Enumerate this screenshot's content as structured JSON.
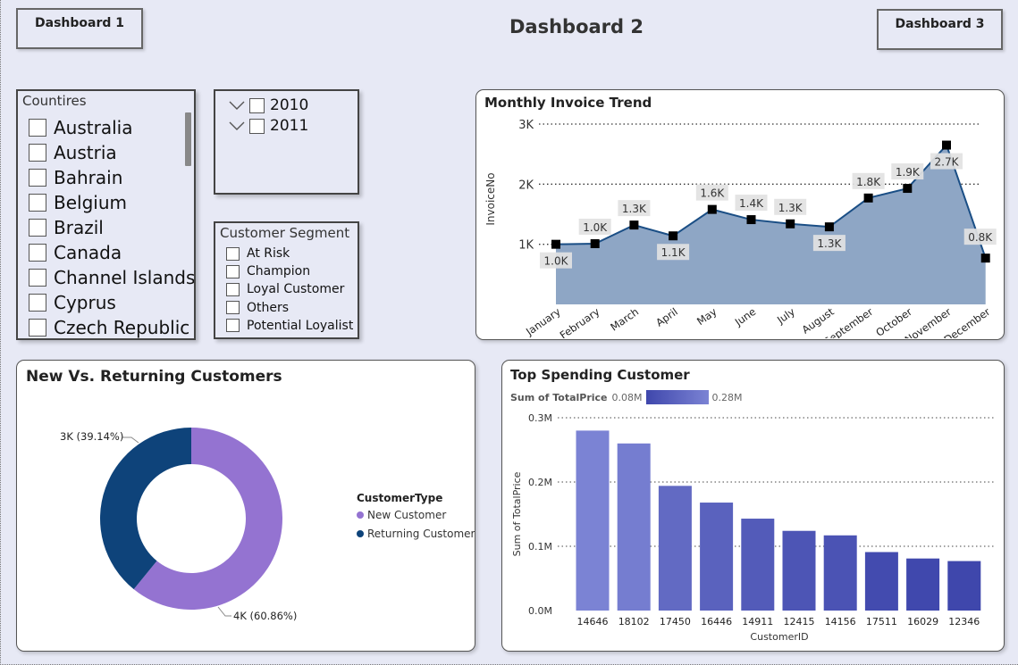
{
  "header": {
    "title": "Dashboard 2",
    "nav_left": "Dashboard 1",
    "nav_right": "Dashboard 3"
  },
  "country_slicer": {
    "title": "Countires",
    "items": [
      "Australia",
      "Austria",
      "Bahrain",
      "Belgium",
      "Brazil",
      "Canada",
      "Channel Islands",
      "Cyprus",
      "Czech Republic"
    ]
  },
  "year_slicer": {
    "items": [
      "2010",
      "2011"
    ]
  },
  "segment_slicer": {
    "title": "Customer Segment",
    "items": [
      "At Risk",
      "Champion",
      "Loyal Customer",
      "Others",
      "Potential Loyalist"
    ]
  },
  "invoice_chart": {
    "title": "Monthly Invoice Trend",
    "chart_data": {
      "type": "area",
      "categories": [
        "January",
        "February",
        "March",
        "April",
        "May",
        "June",
        "July",
        "August",
        "September",
        "October",
        "November",
        "December"
      ],
      "values": [
        1000,
        1010,
        1320,
        1140,
        1580,
        1410,
        1340,
        1290,
        1770,
        1930,
        2650,
        770
      ],
      "data_labels": [
        "1.0K",
        "1.0K",
        "1.3K",
        "1.1K",
        "1.6K",
        "1.4K",
        "1.3K",
        "1.3K",
        "1.8K",
        "1.9K",
        "2.7K",
        "0.8K"
      ],
      "ylabel": "InvoiceNo",
      "y_ticks": [
        "3K",
        "2K",
        "1K"
      ],
      "y_tick_values": [
        3000,
        2000,
        1000
      ],
      "ylim": [
        0,
        3000
      ],
      "grid": true,
      "colors": {
        "line": "#1a4e85",
        "fill": "#8ea6c5",
        "marker": "#000000"
      }
    }
  },
  "donut_chart": {
    "title": "New Vs. Returning Customers",
    "chart_data": {
      "type": "pie",
      "hole": true,
      "legend_title": "CustomerType",
      "slices": [
        {
          "name": "New Customer",
          "share": 60.86,
          "label": "4K (60.86%)",
          "color": "#9473d1"
        },
        {
          "name": "Returning Customer",
          "share": 39.14,
          "label": "3K (39.14%)",
          "color": "#0e437a"
        }
      ]
    }
  },
  "bar_chart": {
    "title": "Top Spending Customer",
    "legend": {
      "title": "Sum of TotalPrice",
      "min_label": "0.08M",
      "max_label": "0.28M"
    },
    "chart_data": {
      "type": "bar",
      "categories": [
        "14646",
        "18102",
        "17450",
        "16446",
        "14911",
        "12415",
        "14156",
        "17511",
        "16029",
        "12346"
      ],
      "values": [
        0.28,
        0.26,
        0.194,
        0.168,
        0.143,
        0.124,
        0.117,
        0.091,
        0.081,
        0.077
      ],
      "xlabel": "CustomerID",
      "ylabel": "Sum of TotalPrice",
      "y_ticks": [
        "0.3M",
        "0.2M",
        "0.1M",
        "0.0M"
      ],
      "y_tick_values": [
        0.3,
        0.2,
        0.1,
        0.0
      ],
      "ylim": [
        0,
        0.3
      ],
      "grid": true,
      "colors": {
        "low": "#3f47ac",
        "high": "#7b83d4"
      }
    }
  }
}
